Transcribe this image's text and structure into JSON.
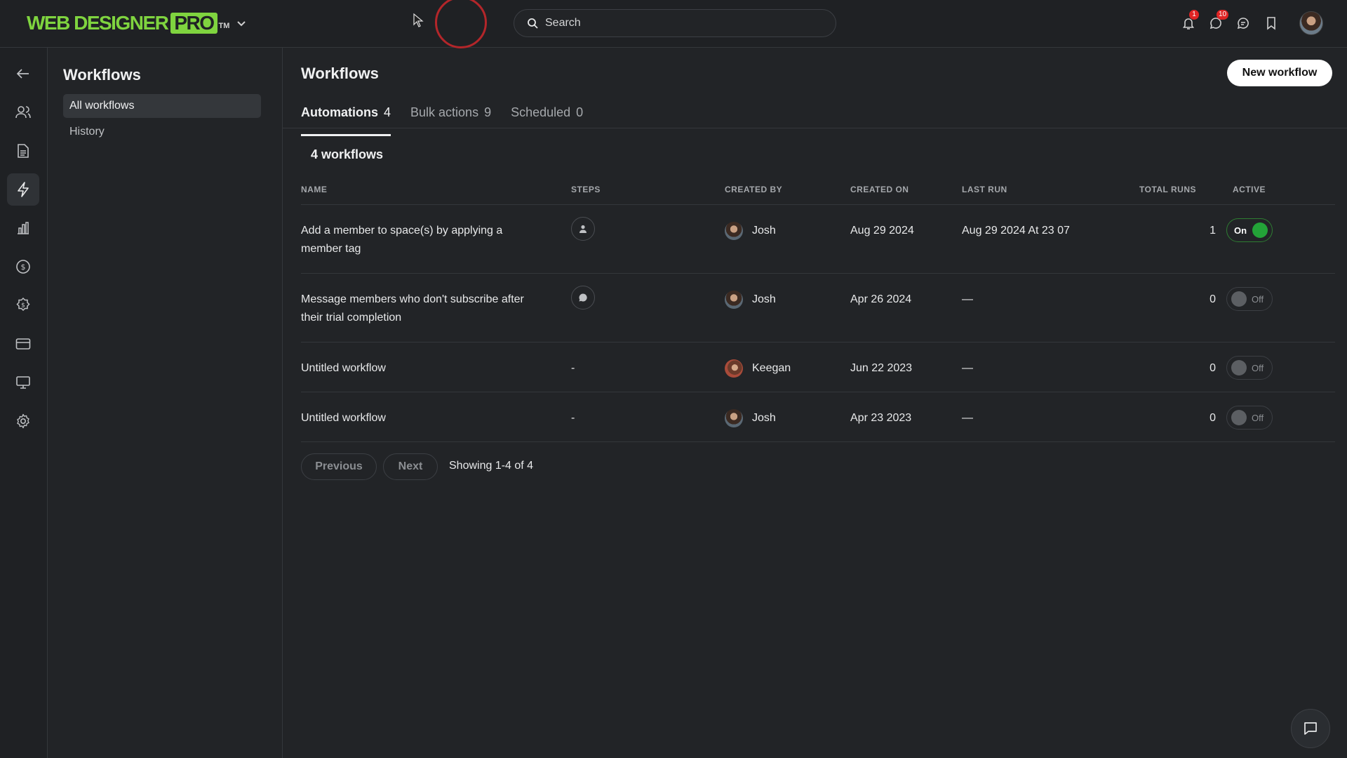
{
  "brand": {
    "name": "WEB DESIGNER",
    "pro": "PRO",
    "tm": "TM"
  },
  "search": {
    "placeholder": "Search"
  },
  "notifications": {
    "bell_count": "1",
    "messages_count": "10"
  },
  "subnav": {
    "title": "Workflows",
    "items": [
      {
        "label": "All workflows",
        "active": true
      },
      {
        "label": "History",
        "active": false
      }
    ]
  },
  "main": {
    "title": "Workflows",
    "new_button": "New workflow",
    "tabs": [
      {
        "label": "Automations",
        "count": "4",
        "active": true
      },
      {
        "label": "Bulk actions",
        "count": "9",
        "active": false
      },
      {
        "label": "Scheduled",
        "count": "0",
        "active": false
      }
    ],
    "workflow_count": "4 workflows",
    "columns": {
      "name": "NAME",
      "steps": "STEPS",
      "created_by": "CREATED BY",
      "created_on": "CREATED ON",
      "last_run": "LAST RUN",
      "total_runs": "TOTAL RUNS",
      "active": "ACTIVE"
    },
    "rows": [
      {
        "name_line1": "Add a member to space(s) by applying a",
        "name_line2": "member tag",
        "steps": "person-icon",
        "created_by": "Josh",
        "created_on": "Aug 29 2024",
        "last_run": "Aug 29 2024 At 23 07",
        "total_runs": "1",
        "active": "On"
      },
      {
        "name_line1": "Message members who don't subscribe after",
        "name_line2": "their trial completion",
        "steps": "message-icon",
        "created_by": "Josh",
        "created_on": "Apr 26 2024",
        "last_run": "—",
        "total_runs": "0",
        "active": "Off"
      },
      {
        "name_line1": "Untitled workflow",
        "name_line2": "",
        "steps": "-",
        "created_by": "Keegan",
        "created_on": "Jun 22 2023",
        "last_run": "—",
        "total_runs": "0",
        "active": "Off"
      },
      {
        "name_line1": "Untitled workflow",
        "name_line2": "",
        "steps": "-",
        "created_by": "Josh",
        "created_on": "Apr 23 2023",
        "last_run": "—",
        "total_runs": "0",
        "active": "Off"
      }
    ],
    "pagination": {
      "previous": "Previous",
      "next": "Next",
      "showing": "Showing 1-4 of 4"
    }
  },
  "colors": {
    "accent_green": "#7fd43f",
    "toggle_on": "#23a338",
    "badge_red": "#e02424",
    "loading_ring": "#b3262a"
  }
}
